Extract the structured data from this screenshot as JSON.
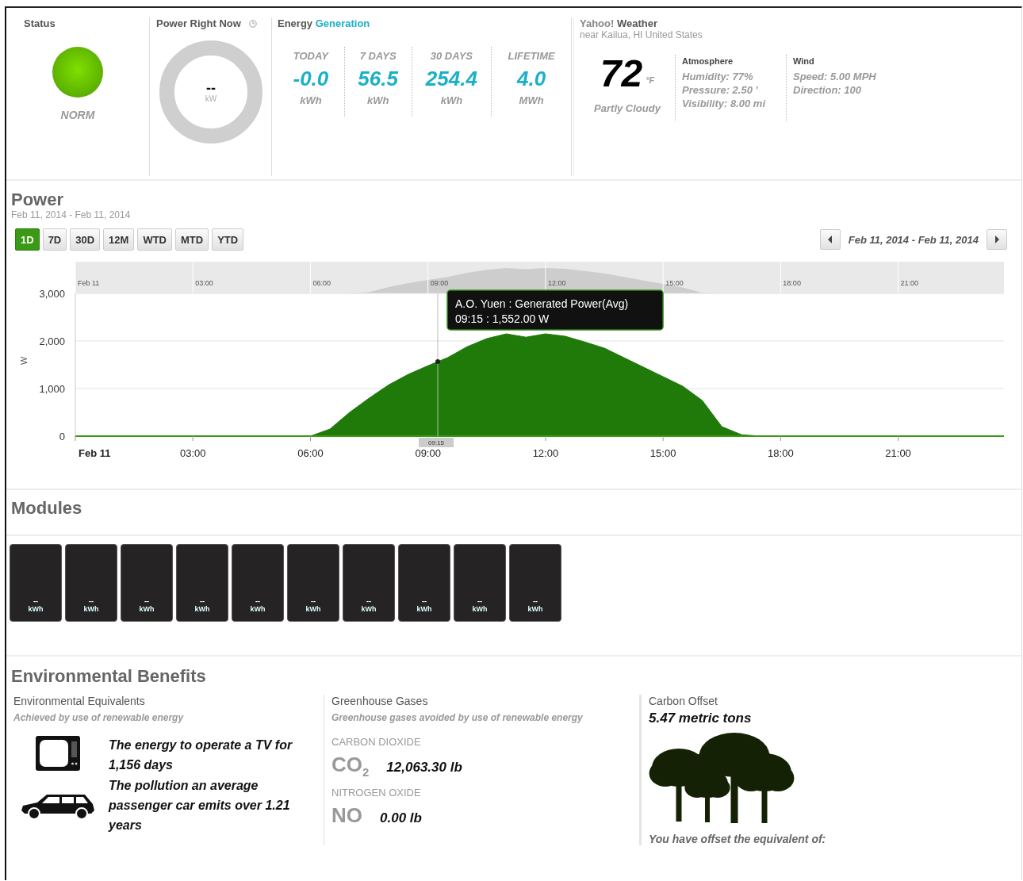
{
  "status": {
    "title": "Status",
    "label": "NORM"
  },
  "power_now": {
    "title": "Power Right Now",
    "value": "--",
    "unit": "kW"
  },
  "energy": {
    "title": "Energy",
    "title_highlight": "Generation",
    "stats": [
      {
        "label": "TODAY",
        "value": "-0.0",
        "unit": "kWh"
      },
      {
        "label": "7 DAYS",
        "value": "56.5",
        "unit": "kWh"
      },
      {
        "label": "30 DAYS",
        "value": "254.4",
        "unit": "kWh"
      },
      {
        "label": "LIFETIME",
        "value": "4.0",
        "unit": "MWh"
      }
    ]
  },
  "weather": {
    "source": "Yahoo!",
    "title": "Weather",
    "location": "near Kailua, HI United States",
    "temperature": "72",
    "unit": "°F",
    "condition": "Partly Cloudy",
    "atmosphere": {
      "title": "Atmosphere",
      "lines": [
        "Humidity: 77%",
        "Pressure: 2.50 '",
        "Visibility: 8.00 mi"
      ]
    },
    "wind": {
      "title": "Wind",
      "lines": [
        "Speed: 5.00 MPH",
        "Direction: 100"
      ]
    }
  },
  "power": {
    "title": "Power",
    "date_range": "Feb 11, 2014 - Feb 11, 2014",
    "ranges": [
      {
        "label": "1D",
        "selected": true
      },
      {
        "label": "7D",
        "selected": false
      },
      {
        "label": "30D",
        "selected": false
      },
      {
        "label": "12M",
        "selected": false
      },
      {
        "label": "WTD",
        "selected": false
      },
      {
        "label": "MTD",
        "selected": false
      },
      {
        "label": "YTD",
        "selected": false
      }
    ],
    "nav_range": "Feb 11, 2014 - Feb 11, 2014",
    "navigator_labels": [
      "Feb 11",
      "03:00",
      "06:00",
      "09:00",
      "12:00",
      "15:00",
      "18:00",
      "21:00"
    ],
    "tooltip": {
      "value": "09:15 : 1,552.00 W"
    },
    "crosshair_label": "09:15",
    "chart_data": {
      "type": "area",
      "ylabel": "W",
      "xlim": [
        0,
        23.7
      ],
      "ylim": [
        0,
        3000
      ],
      "ref_lines": [
        {
          "axis": "x",
          "value": 9.25
        }
      ],
      "xticks": [
        {
          "value": 0,
          "label": "Feb 11"
        },
        {
          "value": 3,
          "label": "03:00"
        },
        {
          "value": 6,
          "label": "06:00"
        },
        {
          "value": 9,
          "label": "09:00"
        },
        {
          "value": 12,
          "label": "12:00"
        },
        {
          "value": 15,
          "label": "15:00"
        },
        {
          "value": 18,
          "label": "18:00"
        },
        {
          "value": 21,
          "label": "21:00"
        }
      ],
      "yticks": [
        {
          "value": 0,
          "label": "0"
        },
        {
          "value": 1000,
          "label": "1,000"
        },
        {
          "value": 2000,
          "label": "2,000"
        },
        {
          "value": 3000,
          "label": "3,000"
        }
      ],
      "x": [
        0,
        0.5,
        1,
        1.5,
        2,
        2.5,
        3,
        3.5,
        4,
        4.5,
        5,
        5.5,
        6,
        6.5,
        7,
        7.5,
        8,
        8.5,
        9,
        9.5,
        10,
        10.5,
        11,
        11.5,
        12,
        12.5,
        13,
        13.5,
        14,
        14.5,
        15,
        15.5,
        16,
        16.5,
        17,
        17.5,
        18,
        18.5,
        19,
        19.5,
        20,
        20.5,
        21,
        21.5,
        22,
        22.5,
        23,
        23.5
      ],
      "series": [
        {
          "name": "A.O. Yuen : Generated Power(Avg)",
          "color": "#1f7a0a",
          "values": [
            0,
            0,
            0,
            0,
            0,
            0,
            0,
            0,
            0,
            0,
            0,
            0,
            0,
            150,
            500,
            800,
            1080,
            1300,
            1480,
            1650,
            1880,
            2050,
            2150,
            2080,
            2150,
            2100,
            1980,
            1850,
            1650,
            1450,
            1250,
            1050,
            750,
            200,
            30,
            0,
            0,
            0,
            0,
            0,
            0,
            0,
            0,
            0,
            0,
            0,
            0,
            0
          ]
        }
      ]
    }
  },
  "modules": {
    "title": "Modules",
    "items": [
      {
        "value": "--",
        "unit": "kWh"
      },
      {
        "value": "--",
        "unit": "kWh"
      },
      {
        "value": "--",
        "unit": "kWh"
      },
      {
        "value": "--",
        "unit": "kWh"
      },
      {
        "value": "--",
        "unit": "kWh"
      },
      {
        "value": "--",
        "unit": "kWh"
      },
      {
        "value": "--",
        "unit": "kWh"
      },
      {
        "value": "--",
        "unit": "kWh"
      },
      {
        "value": "--",
        "unit": "kWh"
      },
      {
        "value": "--",
        "unit": "kWh"
      }
    ]
  },
  "environment": {
    "title": "Environmental Benefits",
    "equivalents": {
      "title": "Environmental Equivalents",
      "subtitle": "Achieved by use of renewable energy",
      "items": [
        {
          "kind": "tv",
          "text": "The energy to operate a TV for 1,156 days"
        },
        {
          "kind": "car",
          "text": "The pollution an average passenger car emits over 1.21 years"
        }
      ]
    },
    "greenhouse": {
      "title": "Greenhouse Gases",
      "subtitle": "Greenhouse gases avoided by use of renewable energy",
      "gases": [
        {
          "name": "CARBON DIOXIDE",
          "formula": "CO$_{2}$",
          "amount": "12,063.30 lb"
        },
        {
          "name": "NITROGEN OXIDE",
          "formula": "NO",
          "amount": "0.00 lb"
        }
      ]
    },
    "carbon": {
      "title": "Carbon Offset",
      "amount": "5.47 metric tons",
      "caption": "You have offset the equivalent of:"
    }
  }
}
